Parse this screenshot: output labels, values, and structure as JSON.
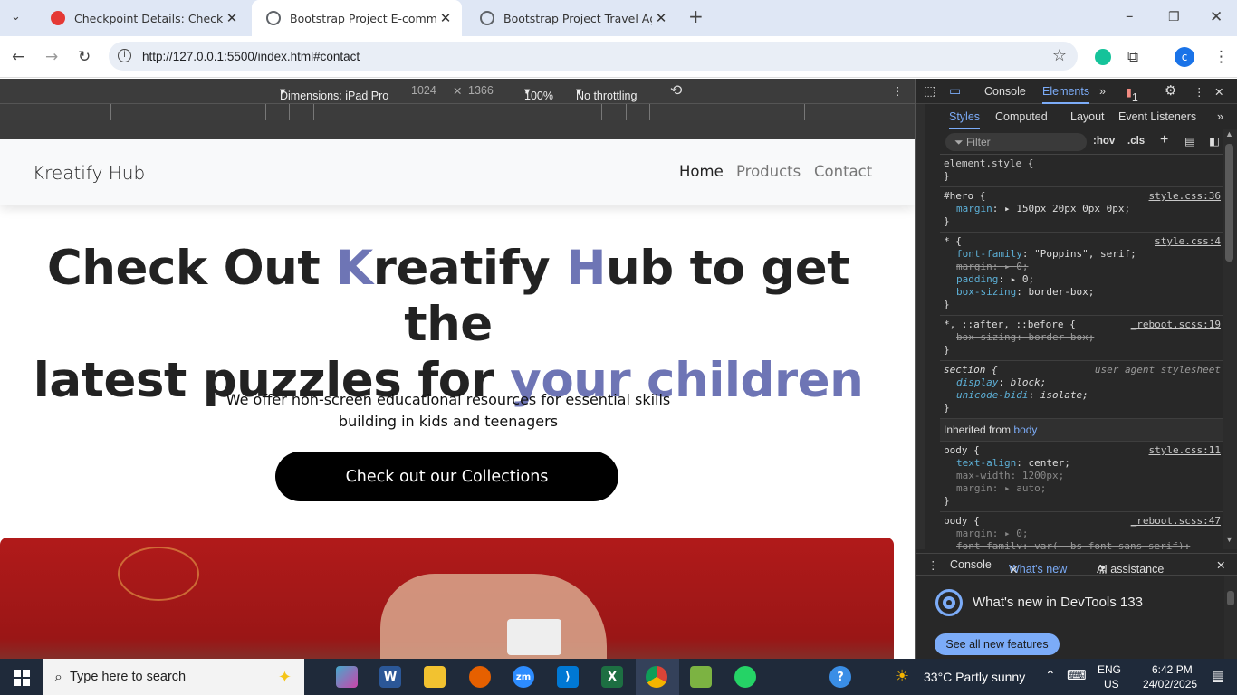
{
  "browser": {
    "tabs": [
      {
        "title": "Checkpoint Details: Checkpoint",
        "favicon_color": "#e53935"
      },
      {
        "title": "Bootstrap Project E-commerce",
        "favicon_color": "#5f6368"
      },
      {
        "title": "Bootstrap Project Travel Agency",
        "favicon_color": "#5f6368"
      }
    ],
    "url": "http://127.0.0.1:5500/index.html#contact",
    "profile_letter": "c"
  },
  "device_toolbar": {
    "dimensions": "Dimensions: iPad Pro",
    "width": "1024",
    "height": "1366",
    "zoom": "100%",
    "throttling": "No throttling"
  },
  "page": {
    "brand": "Kreatify Hub",
    "nav": [
      "Home",
      "Products",
      "Contact"
    ],
    "hero": {
      "line1_a": "Check Out ",
      "line1_b": "K",
      "line1_c": "reatify ",
      "line1_d": "H",
      "line1_e": "ub to get the",
      "line2_a": "latest puzzles for ",
      "line2_b": "your children",
      "subtitle_1": "We offer non-screen educational resources for essential skills",
      "subtitle_2": "building in kids and teenagers",
      "cta": "Check out our Collections"
    },
    "accent_color": "#6e75b5"
  },
  "devtools": {
    "tabs": [
      "Console",
      "Elements"
    ],
    "error_count": "1",
    "subtabs": [
      "Styles",
      "Computed",
      "Layout",
      "Event Listeners"
    ],
    "filter_placeholder": "Filter",
    "hov": ":hov",
    "cls": ".cls",
    "rules": {
      "element_style": "element.style {",
      "hero_selector": "#hero {",
      "hero_src": "style.css:36",
      "hero_prop": "margin",
      "hero_val": "150px 20px 0px 0px;",
      "star_selector": "* {",
      "star_src": "style.css:4",
      "star_p1": "font-family",
      "star_v1": "\"Poppins\", serif;",
      "star_p2": "margin",
      "star_v2": "0;",
      "star_p3": "padding",
      "star_v3": "0;",
      "star_p4": "box-sizing",
      "star_v4": "border-box;",
      "reboot_selector": "*, ::after, ::before {",
      "reboot_src": "_reboot.scss:19",
      "reboot_p1": "box-sizing: border-box;",
      "section_selector": "section {",
      "section_src": "user agent stylesheet",
      "section_p1": "display",
      "section_v1": "block;",
      "section_p2": "unicode-bidi",
      "section_v2": "isolate;",
      "inherited_label": "Inherited from",
      "inherited_el": "body",
      "body_selector": "body {",
      "body_src": "style.css:11",
      "body_p1": "text-align",
      "body_v1": "center;",
      "body_p2": "max-width",
      "body_v2": "1200px;",
      "body_p3": "margin",
      "body_v3": "auto;",
      "body2_selector": "body {",
      "body2_src": "_reboot.scss:47",
      "body2_p1": "margin",
      "body2_v1": "0;",
      "body2_p2": "font-family: var(--bs-font-sans-serif);"
    },
    "drawer_tabs": [
      "Console",
      "What's new",
      "AI assistance"
    ],
    "whats_new_title": "What's new in DevTools 133",
    "whats_new_button": "See all new features"
  },
  "taskbar": {
    "search_placeholder": "Type here to search",
    "weather": "33°C  Partly sunny",
    "lang_1": "ENG",
    "lang_2": "US",
    "time": "6:42 PM",
    "date": "24/02/2025"
  }
}
